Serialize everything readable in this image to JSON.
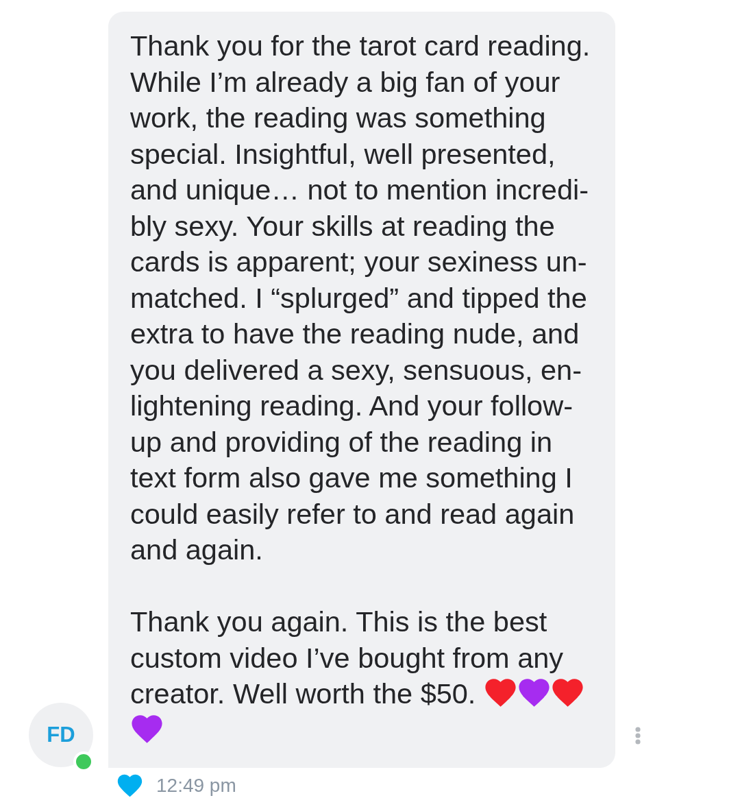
{
  "message": {
    "paragraphs": [
      {
        "text": "Thank you for the tarot card reading.\nWhile I’m already a big fan of your\nwork, the reading was something\nspecial. Insightful, well presented,\nand unique… not to mention incredi-\nbly sexy. Your skills at reading the\ncards is apparent; your sexiness un-\nmatched. I “splurged” and tipped the\nextra to have the reading nude, and\nyou delivered a sexy, sensuous, en-\nlightening reading. And your follow-\nup and providing of the reading in\ntext form also gave me something I\ncould easily refer to and read again\nand again."
      },
      {
        "text": "Thank you again. This is the best\ncustom video I’ve bought from any\ncreator. Well worth the $50.",
        "emojis": [
          {
            "color": "#f4212b"
          },
          {
            "color": "#a62cf0"
          },
          {
            "color": "#f4212b"
          },
          {
            "color": "#a62cf0"
          }
        ]
      }
    ]
  },
  "sender": {
    "initials": "FD",
    "online": true
  },
  "footer": {
    "liked": true,
    "time": "12:49 pm"
  }
}
